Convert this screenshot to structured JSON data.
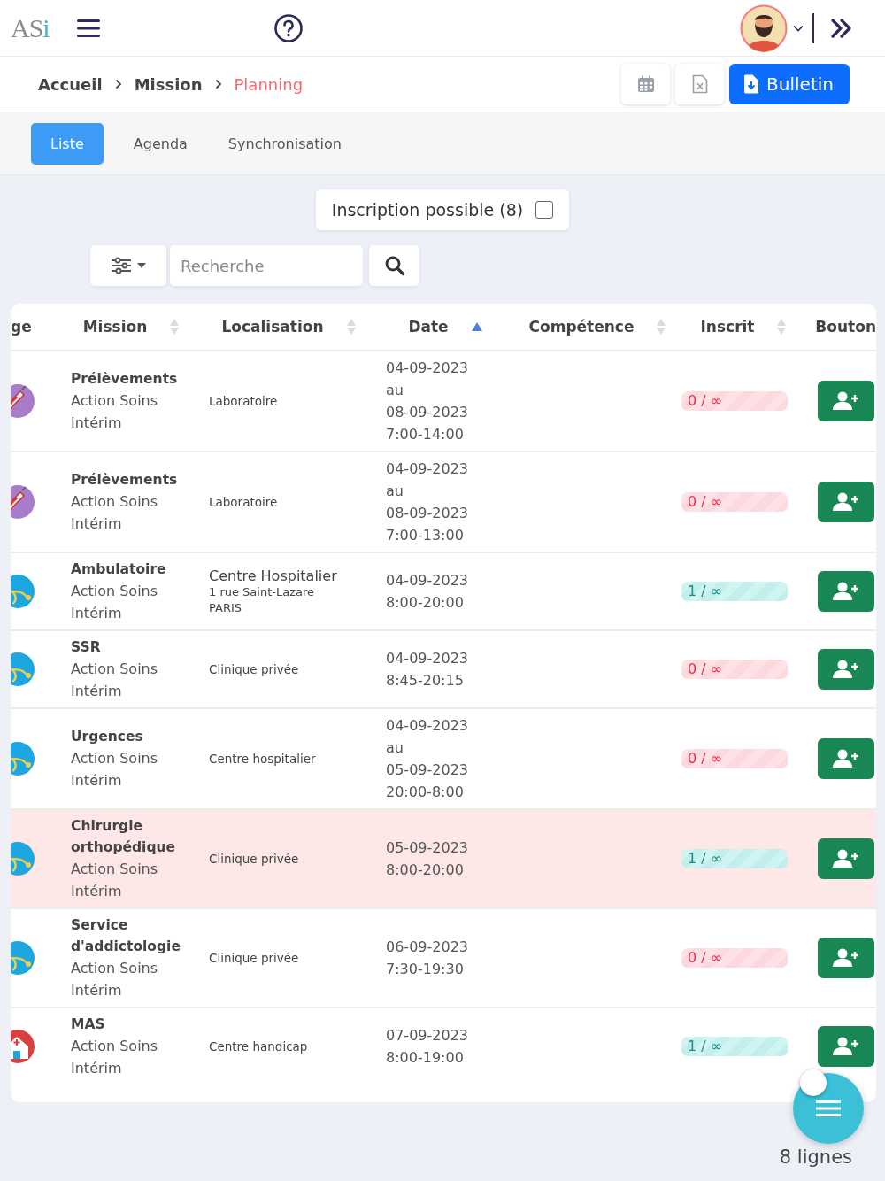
{
  "header": {
    "logo": "ASi"
  },
  "breadcrumb": [
    {
      "label": "Accueil",
      "current": false
    },
    {
      "label": "Mission",
      "current": false
    },
    {
      "label": "Planning",
      "current": true
    }
  ],
  "actions": {
    "primary": "Bulletin"
  },
  "tabs": [
    {
      "label": "Liste",
      "selected": true
    },
    {
      "label": "Agenda",
      "selected": false
    },
    {
      "label": "Synchronisation",
      "selected": false
    }
  ],
  "filter": {
    "label": "Inscription possible (8)",
    "checked": false
  },
  "search": {
    "placeholder": "Recherche"
  },
  "table": {
    "columns": [
      {
        "label": "ge"
      },
      {
        "label": "Mission",
        "sorted": false
      },
      {
        "label": "Localisation",
        "sorted": false
      },
      {
        "label": "Date",
        "sorted": true
      },
      {
        "label": "Compétence",
        "sorted": false
      },
      {
        "label": "Inscrit",
        "sorted": false
      },
      {
        "label": "Bouton"
      }
    ],
    "rows": [
      {
        "kind": "lab",
        "color": "#a87cc8",
        "mission": [
          "Prélèvements",
          "Action Soins",
          "Intérim"
        ],
        "location": {
          "name": "Laboratoire"
        },
        "date": [
          "04-09-2023",
          "au",
          "08-09-2023",
          "7:00-14:00"
        ],
        "inscrit": "0 / ∞",
        "registered": false,
        "highlighted": false
      },
      {
        "kind": "lab",
        "color": "#a87cc8",
        "mission": [
          "Prélèvements",
          "Action Soins",
          "Intérim"
        ],
        "location": {
          "name": "Laboratoire"
        },
        "date": [
          "04-09-2023",
          "au",
          "08-09-2023",
          "7:00-13:00"
        ],
        "inscrit": "0 / ∞",
        "registered": false,
        "highlighted": false
      },
      {
        "kind": "care",
        "color": "#1ea6e0",
        "mission": [
          "Ambulatoire",
          "Action Soins",
          "Intérim"
        ],
        "location": {
          "name": "Centre Hospitalier",
          "address": [
            "1 rue Saint-Lazare",
            "PARIS"
          ]
        },
        "date": [
          "04-09-2023",
          "8:00-20:00"
        ],
        "inscrit": "1 / ∞",
        "registered": true,
        "highlighted": false
      },
      {
        "kind": "care",
        "color": "#1ea6e0",
        "mission": [
          "SSR",
          "Action Soins",
          "Intérim"
        ],
        "location": {
          "name": "Clinique privée"
        },
        "date": [
          "04-09-2023",
          "8:45-20:15"
        ],
        "inscrit": "0 / ∞",
        "registered": false,
        "highlighted": false
      },
      {
        "kind": "care",
        "color": "#1ea6e0",
        "mission": [
          "Urgences",
          "Action Soins",
          "Intérim"
        ],
        "location": {
          "name": "Centre hospitalier"
        },
        "date": [
          "04-09-2023",
          "au",
          "05-09-2023",
          "20:00-8:00"
        ],
        "inscrit": "0 / ∞",
        "registered": false,
        "highlighted": false
      },
      {
        "kind": "care",
        "color": "#1ea6e0",
        "mission": [
          "Chirurgie orthopédique",
          "Action Soins",
          "Intérim"
        ],
        "location": {
          "name": "Clinique privée"
        },
        "date": [
          "05-09-2023",
          "8:00-20:00"
        ],
        "inscrit": "1 / ∞",
        "registered": true,
        "highlighted": true
      },
      {
        "kind": "care",
        "color": "#1ea6e0",
        "mission": [
          "Service d'addictologie",
          "Action Soins",
          "Intérim"
        ],
        "location": {
          "name": "Clinique privée"
        },
        "date": [
          "06-09-2023",
          "7:30-19:30"
        ],
        "inscrit": "0 / ∞",
        "registered": false,
        "highlighted": false
      },
      {
        "kind": "home",
        "color": "#d8413f",
        "mission": [
          "MAS",
          "Action Soins",
          "Intérim"
        ],
        "location": {
          "name": "Centre handicap"
        },
        "date": [
          "07-09-2023",
          "8:00-19:00"
        ],
        "inscrit": "1 / ∞",
        "registered": true,
        "highlighted": false
      }
    ]
  },
  "footer": {
    "count": "8 lignes"
  }
}
